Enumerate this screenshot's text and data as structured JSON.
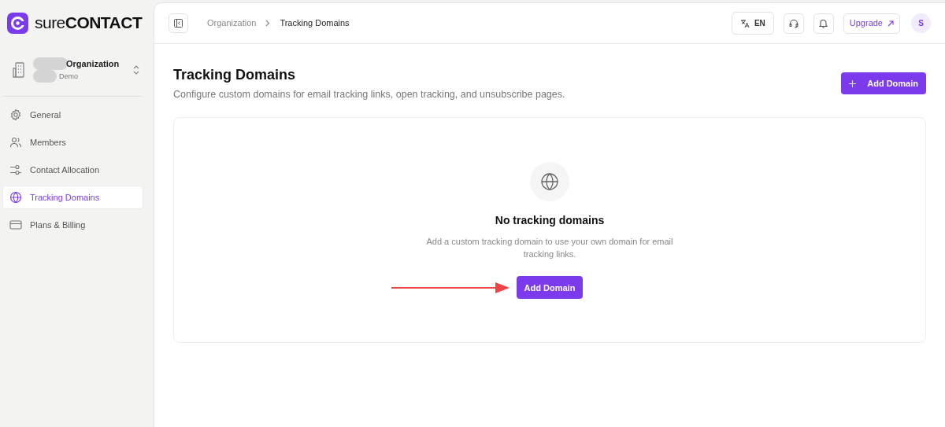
{
  "brand": {
    "name": "sure**CONTACT**"
  },
  "organization": {
    "name": "Organization",
    "plan": "Demo"
  },
  "sidebar": {
    "items": [
      {
        "label": "General",
        "kind": "settings",
        "selected": false
      },
      {
        "label": "Members",
        "kind": "team",
        "selected": false
      },
      {
        "label": "Contact Allocation",
        "kind": "allocation",
        "selected": false
      },
      {
        "label": "Tracking Domains",
        "kind": "domains",
        "selected": true
      },
      {
        "label": "Plans & Billing",
        "kind": "billing",
        "selected": false
      }
    ]
  },
  "topbar": {
    "breadcrumb": [
      "Organization",
      "Tracking Domains"
    ],
    "language": "EN",
    "upgrade": "Upgrade",
    "avatar": "S"
  },
  "page": {
    "title": "Tracking Domains",
    "subtitle": "Configure custom domains for email tracking links, open tracking, and unsubscribe pages.",
    "add_button": "Add Domain"
  },
  "empty_state": {
    "title": "No tracking domains",
    "description": "Add a custom tracking domain to use your own domain for email tracking links.",
    "button": "Add Domain"
  }
}
